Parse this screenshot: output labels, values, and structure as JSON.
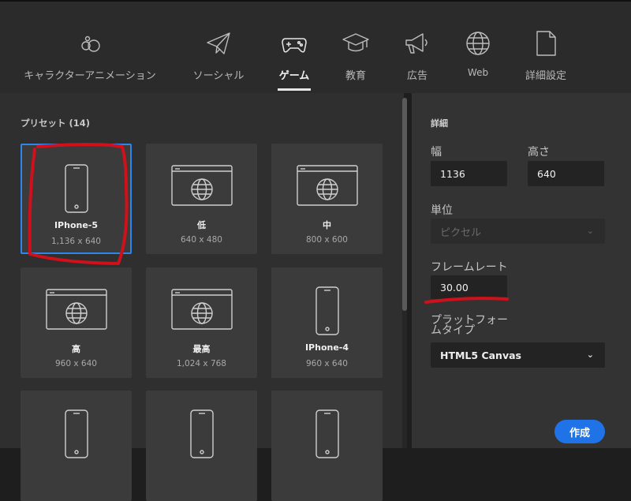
{
  "categories": [
    {
      "label": "キャラクターアニメーション",
      "icon": "character-animation-icon"
    },
    {
      "label": "ソーシャル",
      "icon": "paper-plane-icon"
    },
    {
      "label": "ゲーム",
      "icon": "gamepad-icon",
      "active": true
    },
    {
      "label": "教育",
      "icon": "graduation-cap-icon"
    },
    {
      "label": "広告",
      "icon": "megaphone-icon"
    },
    {
      "label": "Web",
      "icon": "globe-icon"
    },
    {
      "label": "詳細設定",
      "icon": "document-icon"
    }
  ],
  "presets": {
    "title": "プリセット (14)",
    "items": [
      {
        "name": "IPhone-5",
        "size": "1,136 x 640",
        "icon": "phone-icon",
        "selected": true
      },
      {
        "name": "低",
        "size": "640 x 480",
        "icon": "browser-globe-icon"
      },
      {
        "name": "中",
        "size": "800 x 600",
        "icon": "browser-globe-icon"
      },
      {
        "name": "高",
        "size": "960 x 640",
        "icon": "browser-globe-icon"
      },
      {
        "name": "最高",
        "size": "1,024 x 768",
        "icon": "browser-globe-icon"
      },
      {
        "name": "IPhone-4",
        "size": "960 x 640",
        "icon": "phone-icon"
      }
    ]
  },
  "details": {
    "title": "詳細",
    "width_label": "幅",
    "width_value": "1136",
    "height_label": "高さ",
    "height_value": "640",
    "unit_label": "単位",
    "unit_value": "ピクセル",
    "framerate_label": "フレームレート",
    "framerate_value": "30.00",
    "platform_label_line1": "プラットフォー",
    "platform_label_line2": "ムタイプ",
    "platform_value": "HTML5 Canvas",
    "create_label": "作成"
  },
  "colors": {
    "accent": "#2d86ea",
    "create_button": "#1f73e6",
    "annotation_red": "#d0101a"
  }
}
